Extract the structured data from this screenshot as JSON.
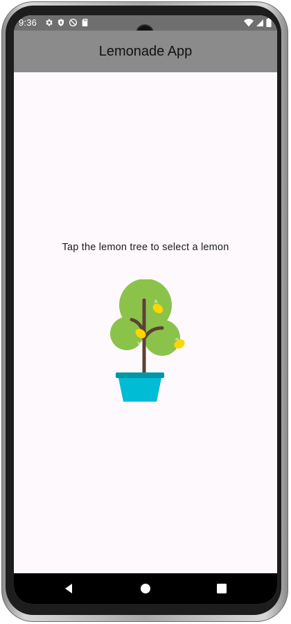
{
  "status_bar": {
    "time": "9:36",
    "left_icons": [
      "settings-icon",
      "shield-icon",
      "no-disturb-icon",
      "sd-card-icon"
    ],
    "right_icons": [
      "wifi-icon",
      "signal-icon",
      "battery-icon"
    ]
  },
  "app_bar": {
    "title": "Lemonade App"
  },
  "main": {
    "instruction": "Tap the lemon tree to select a lemon",
    "image": {
      "icon": "lemon-tree-icon"
    }
  },
  "nav_bar": {
    "buttons": [
      "back-icon",
      "home-icon",
      "recents-icon"
    ]
  },
  "colors": {
    "app_bar": "#8b8b8b",
    "status_bar": "#6f6f6f",
    "background": "#fdf9fd",
    "foliage": "#8bc34a",
    "trunk": "#5d4037",
    "pot": "#00bcd4",
    "pot_rim": "#0097a7",
    "lemon": "#ffd600"
  }
}
